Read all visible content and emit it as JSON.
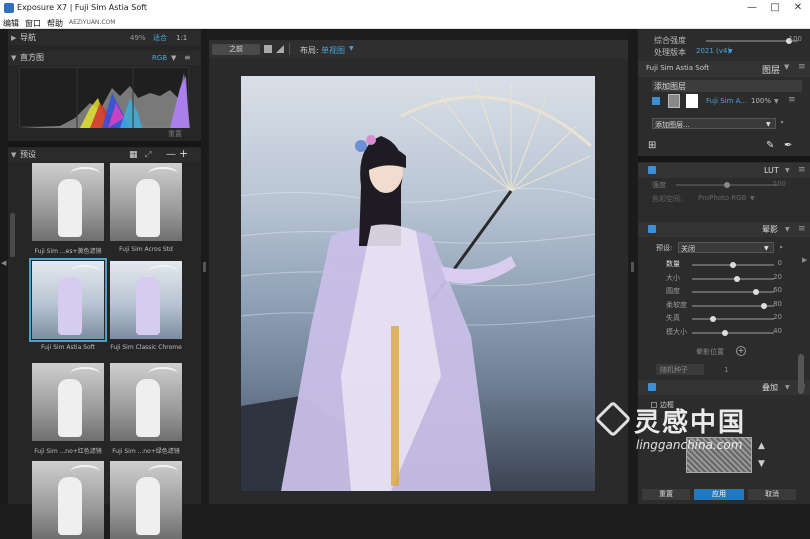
{
  "window": {
    "title": "Exposure X7 | Fuji Sim Astia Soft"
  },
  "menu": {
    "items": [
      "编辑",
      "窗口",
      "帮助"
    ],
    "watermark": "AEZIYUAN.COM"
  },
  "left": {
    "nav": {
      "label": "导航",
      "zoom": "49%",
      "fit": "适合",
      "one": "1:1"
    },
    "histogram": {
      "label": "直方图",
      "mode": "RGB",
      "reset": "重置"
    },
    "presets": {
      "label": "预设",
      "items": [
        {
          "name": "Fuji Sim ...es+黄色滤镜",
          "tone": "bw"
        },
        {
          "name": "Fuji Sim Acros Std",
          "tone": "bw"
        },
        {
          "name": "Fuji Sim Astia Soft",
          "tone": "color",
          "selected": true
        },
        {
          "name": "Fuji Sim Classic Chrome",
          "tone": "color"
        },
        {
          "name": "Fuji Sim ...no+红色滤镜",
          "tone": "bw"
        },
        {
          "name": "Fuji Sim ...no+绿色滤镜",
          "tone": "bw"
        },
        {
          "name": "",
          "tone": "bw"
        },
        {
          "name": "",
          "tone": "bw"
        }
      ]
    }
  },
  "toolbar": {
    "before": "之前",
    "layout_label": "布局:",
    "layout_value": "单视图"
  },
  "right": {
    "overall_strength": {
      "label": "综合强度",
      "value": "100",
      "level": 0.9
    },
    "process_version": {
      "label": "处理版本",
      "value": "2021 (v4)"
    },
    "preset_name": "Fuji Sim Astia Soft",
    "layers_label": "图层",
    "add_layer_top": "添加图层",
    "layer_row": {
      "name": "Fuji Sim A...",
      "opacity": "100%"
    },
    "add_layer_select": "添加图层...",
    "lut": {
      "label": "LUT",
      "strength_label": "强度",
      "strength_value": "100",
      "level": 0.5,
      "colorspace_label": "色彩空间:",
      "colorspace_value": "ProPhoto RGB"
    },
    "vignette": {
      "label": "晕影",
      "preset_label": "预设:",
      "preset_value": "关闭",
      "rows": [
        {
          "label": "数量",
          "value": "0",
          "level": 0.5
        },
        {
          "label": "大小",
          "value": "20",
          "level": 0.55
        },
        {
          "label": "圆度",
          "value": "60",
          "level": 0.78
        },
        {
          "label": "柔软度",
          "value": "80",
          "level": 0.88
        },
        {
          "label": "失真",
          "value": "20",
          "level": 0.25
        },
        {
          "label": "模大小",
          "value": "40",
          "level": 0.4
        }
      ],
      "position_label": "晕影位置",
      "seed_label": "随机种子",
      "seed_value": "1"
    },
    "overlay": {
      "label": "叠加",
      "border_label": "边框"
    },
    "buttons": {
      "reset": "重置",
      "apply": "应用",
      "cancel": "取消"
    }
  },
  "watermark": {
    "cn": "灵感中国",
    "url": "lingganchina.com"
  },
  "colors": {
    "accent": "#3a8fd6",
    "panel": "#262626",
    "selected": "#4aa3c8"
  }
}
